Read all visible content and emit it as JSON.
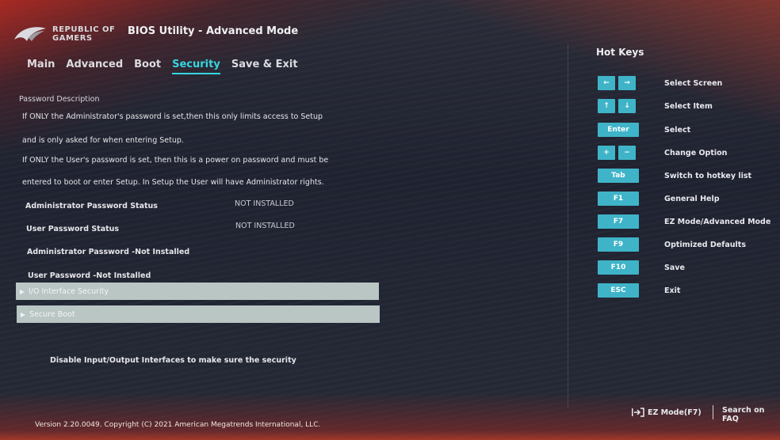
{
  "header": {
    "logo_line1": "REPUBLIC OF",
    "logo_line2": "GAMERS",
    "title": "BIOS Utility - Advanced Mode"
  },
  "tabs": [
    {
      "label": "Main",
      "active": false
    },
    {
      "label": "Advanced",
      "active": false
    },
    {
      "label": "Boot",
      "active": false
    },
    {
      "label": "Security",
      "active": true
    },
    {
      "label": "Save & Exit",
      "active": false
    }
  ],
  "main": {
    "desc_title": "Password Description",
    "desc_lines": [
      "If ONLY the Administrator's password is set,then this only limits access to Setup",
      "and is only asked for when entering Setup.",
      "If ONLY the User's password is set, then this is a power on password and must be",
      "entered to boot or enter Setup. In Setup the User will have Administrator rights."
    ],
    "status_rows": [
      {
        "label": "Administrator Password Status",
        "value": "NOT INSTALLED"
      },
      {
        "label": "User Password Status",
        "value": "NOT INSTALLED"
      }
    ],
    "password_rows": [
      "Administrator Password -Not Installed",
      "User Password -Not Installed"
    ],
    "submenus": [
      "I/O Interface Security",
      "Secure Boot"
    ],
    "help_text": "Disable Input/Output Interfaces to make sure the security"
  },
  "hotkeys": {
    "title": "Hot Keys",
    "items": [
      {
        "keys": [
          "←",
          "→"
        ],
        "label": "Select Screen"
      },
      {
        "keys": [
          "↑",
          "↓"
        ],
        "label": "Select Item"
      },
      {
        "keys": [
          "Enter"
        ],
        "label": "Select"
      },
      {
        "keys": [
          "+",
          "−"
        ],
        "label": "Change Option"
      },
      {
        "keys": [
          "Tab"
        ],
        "label": "Switch to hotkey list"
      },
      {
        "keys": [
          "F1"
        ],
        "label": "General Help"
      },
      {
        "keys": [
          "F7"
        ],
        "label": "EZ Mode/Advanced Mode"
      },
      {
        "keys": [
          "F9"
        ],
        "label": "Optimized Defaults"
      },
      {
        "keys": [
          "F10"
        ],
        "label": "Save"
      },
      {
        "keys": [
          "ESC"
        ],
        "label": "Exit"
      }
    ]
  },
  "footer": {
    "version": "Version 2.20.0049. Copyright (C) 2021 American Megatrends International, LLC.",
    "ez_mode": "EZ Mode(F7)",
    "search_faq": "Search on FAQ"
  },
  "colors": {
    "accent": "#35d6e0",
    "key_bg": "#3fb4c8",
    "submenu_bg": "#b9c6c4"
  }
}
